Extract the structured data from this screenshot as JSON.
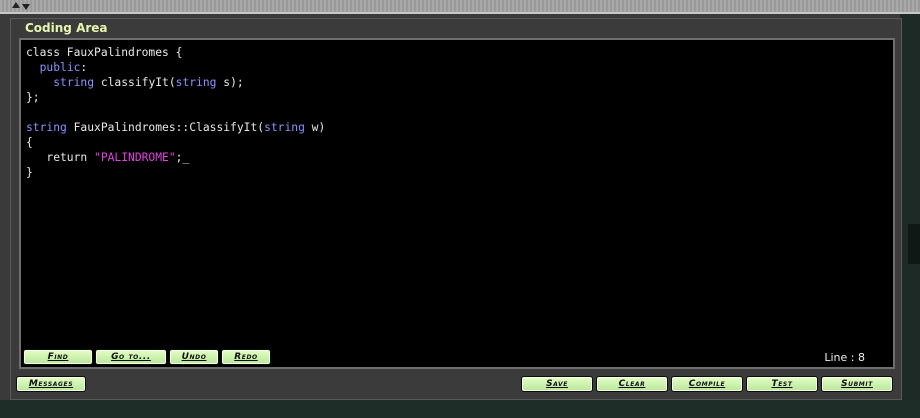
{
  "panel": {
    "title": "Coding Area"
  },
  "editor": {
    "lines": [
      [
        {
          "t": "class FauxPalindromes {",
          "c": "plain"
        }
      ],
      [
        {
          "t": "  ",
          "c": "plain"
        },
        {
          "t": "public",
          "c": "kw"
        },
        {
          "t": ":",
          "c": "plain"
        }
      ],
      [
        {
          "t": "    ",
          "c": "plain"
        },
        {
          "t": "string",
          "c": "kw"
        },
        {
          "t": " classifyIt(",
          "c": "plain"
        },
        {
          "t": "string",
          "c": "kw"
        },
        {
          "t": " s);",
          "c": "plain"
        }
      ],
      [
        {
          "t": "};",
          "c": "plain"
        }
      ],
      [
        {
          "t": "",
          "c": "plain"
        }
      ],
      [
        {
          "t": "string",
          "c": "kw"
        },
        {
          "t": " FauxPalindromes::ClassifyIt(",
          "c": "plain"
        },
        {
          "t": "string",
          "c": "kw"
        },
        {
          "t": " w)",
          "c": "plain"
        }
      ],
      [
        {
          "t": "{",
          "c": "plain"
        }
      ],
      [
        {
          "t": "   return ",
          "c": "plain"
        },
        {
          "t": "\"PALINDROME\"",
          "c": "str"
        },
        {
          "t": ";_",
          "c": "plain"
        }
      ],
      [
        {
          "t": "}",
          "c": "plain"
        }
      ]
    ],
    "buttons": {
      "find": "Find",
      "goto": "Go to...",
      "undo": "Undo",
      "redo": "Redo"
    },
    "line_indicator": "Line : 8"
  },
  "footer": {
    "messages": "Messages",
    "save": "Save",
    "clear": "Clear",
    "compile": "Compile",
    "test": "Test",
    "submit": "Submit"
  },
  "colors": {
    "keyword": "#8a92ff",
    "string": "#e040e0",
    "button_bg": "#c8f0a8",
    "title": "#e7f5b0"
  }
}
